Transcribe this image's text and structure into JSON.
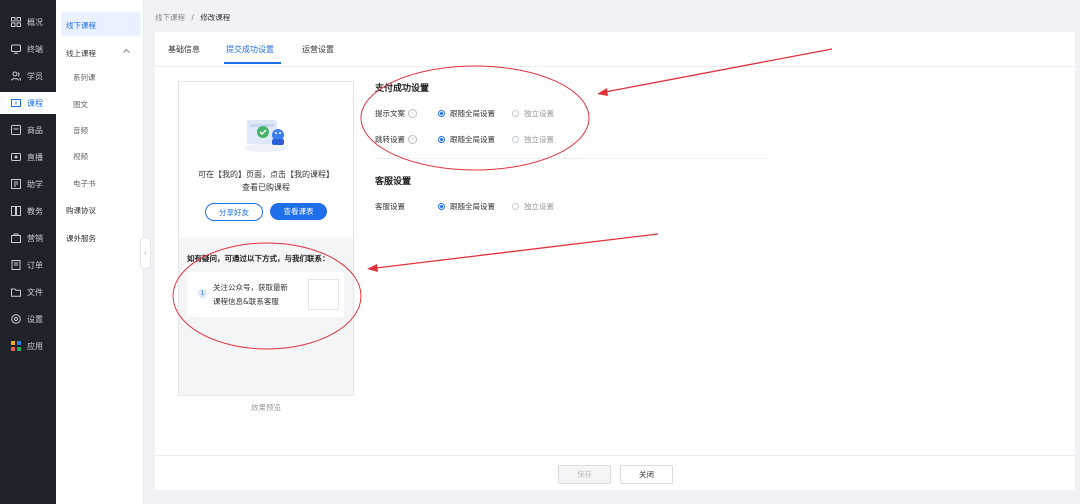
{
  "nav": {
    "items": [
      {
        "label": "概况",
        "icon": "grid-icon"
      },
      {
        "label": "终端",
        "icon": "terminal-icon"
      },
      {
        "label": "学员",
        "icon": "users-icon"
      },
      {
        "label": "课程",
        "icon": "course-icon"
      },
      {
        "label": "商品",
        "icon": "goods-icon"
      },
      {
        "label": "直播",
        "icon": "live-icon"
      },
      {
        "label": "助学",
        "icon": "assist-icon"
      },
      {
        "label": "教务",
        "icon": "academic-icon"
      },
      {
        "label": "营销",
        "icon": "marketing-icon"
      },
      {
        "label": "订单",
        "icon": "order-icon"
      },
      {
        "label": "文件",
        "icon": "folder-icon"
      },
      {
        "label": "设置",
        "icon": "settings-icon"
      },
      {
        "label": "应用",
        "icon": "apps-icon"
      }
    ],
    "active_index": 3,
    "accent_color": "#1f6feb",
    "background_color": "#1f2329"
  },
  "subnav": {
    "offline_course": "线下课程",
    "online_course": "线上课程",
    "online_children": [
      "系列课",
      "图文",
      "音频",
      "视频",
      "电子书"
    ],
    "purchase_agreement": "购课协议",
    "extra_service": "课外服务"
  },
  "breadcrumb": {
    "parent": "线下课程",
    "separator": "/",
    "current": "修改课程"
  },
  "tabs": [
    {
      "label": "基础信息",
      "active": false
    },
    {
      "label": "提交成功设置",
      "active": true
    },
    {
      "label": "运营设置",
      "active": false
    }
  ],
  "preview": {
    "success_line1": "可在【我的】页面，点击【我的课程】",
    "success_line2": "查看已购课程",
    "share_button": "分享好友",
    "view_button": "查看课表",
    "contact_title": "如有疑问，可通过以下方式，与我们联系：",
    "step_number": "1",
    "step_text": "关注公众号，获取最新课程信息&联系客服",
    "caption": "效果预览"
  },
  "payment_settings": {
    "title": "支付成功设置",
    "rows": [
      {
        "label": "提示文案",
        "options": [
          "跟随全局设置",
          "独立设置"
        ],
        "selected": 0
      },
      {
        "label": "跳转设置",
        "options": [
          "跟随全局设置",
          "独立设置"
        ],
        "selected": 0
      }
    ]
  },
  "service_settings": {
    "title": "客服设置",
    "rows": [
      {
        "label": "客服设置",
        "options": [
          "跟随全局设置",
          "独立设置"
        ],
        "selected": 0
      }
    ]
  },
  "footer": {
    "save": "保存",
    "close": "关闭"
  },
  "annotation_color": "#e0323c"
}
